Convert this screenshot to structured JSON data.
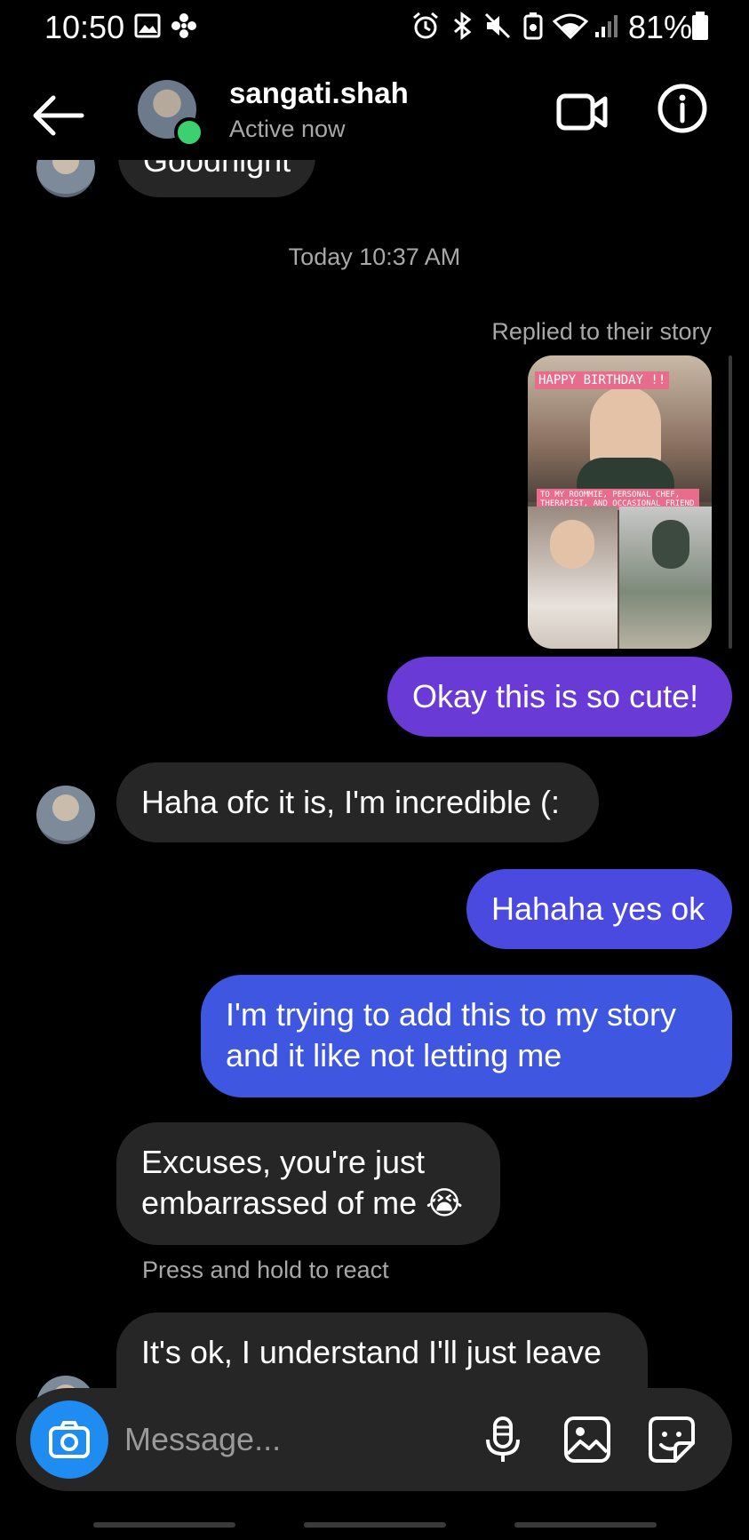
{
  "status_bar": {
    "time": "10:50",
    "battery": "81%"
  },
  "header": {
    "name": "sangati.shah",
    "status": "Active now"
  },
  "conversation": {
    "cut_top_text": "Goodnight",
    "timestamp": "Today 10:37 AM",
    "story_reply": {
      "label": "Replied to their story",
      "story_text_top": "HAPPY BIRTHDAY !!",
      "story_text_mid": "TO MY ROOMMIE, PERSONAL CHEF, THERAPIST, AND OCCASIONAL FRIEND"
    },
    "messages": [
      {
        "from": "me",
        "text": "Okay this is so cute!"
      },
      {
        "from": "them",
        "text": "Haha ofc it is, I'm incredible (:"
      },
      {
        "from": "me",
        "text": "Hahaha yes ok"
      },
      {
        "from": "me",
        "text": "I'm trying to add this to my story and it like not letting me"
      },
      {
        "from": "them",
        "text": "Excuses, you're just embarrassed of me 😭"
      },
      {
        "from": "them",
        "text": "It's ok, I understand I'll just leave"
      }
    ],
    "react_hint": "Press and hold to react"
  },
  "composer": {
    "placeholder": "Message..."
  },
  "colors": {
    "sent_purple": "#6a3ad6",
    "sent_blue": "#3f56e0",
    "received": "#262626",
    "online": "#3bd16f",
    "camera": "#1e8cf0"
  }
}
